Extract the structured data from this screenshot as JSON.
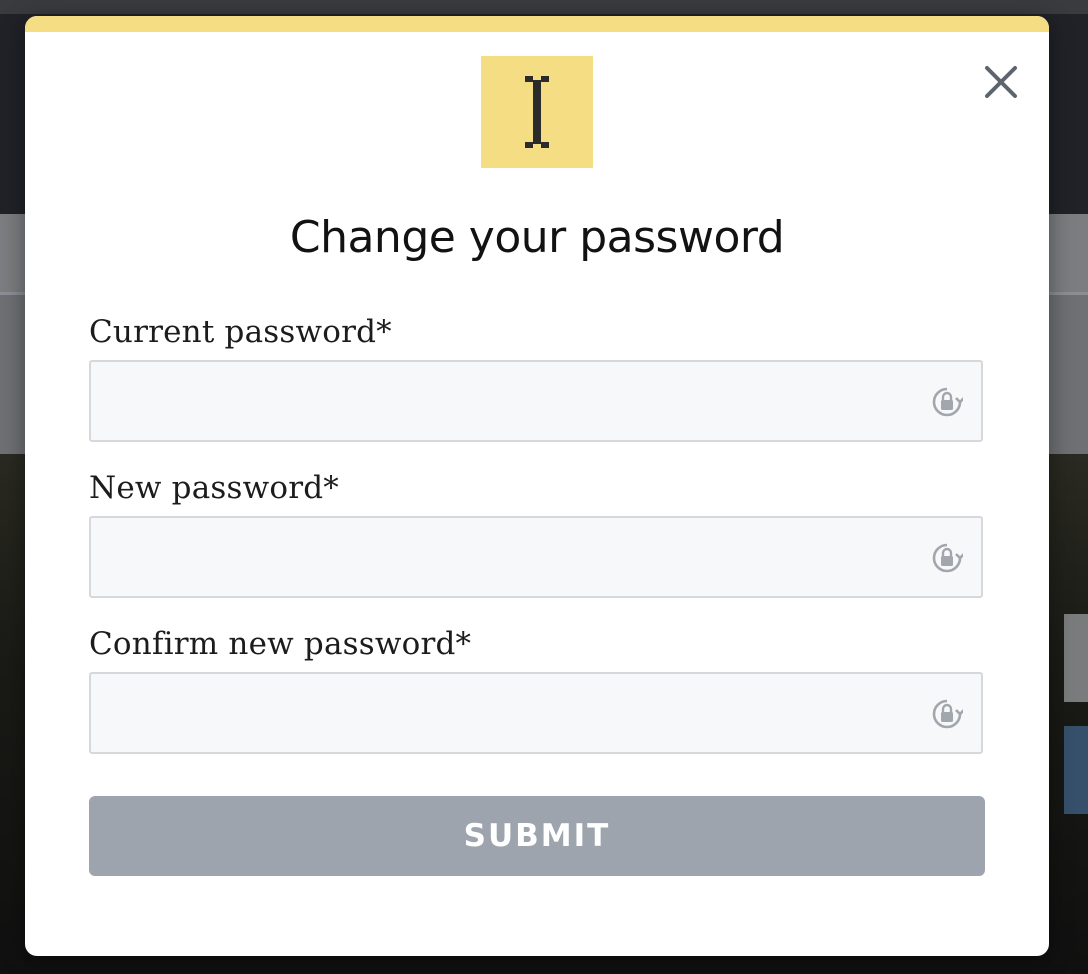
{
  "modal": {
    "title": "Change your password",
    "accent_color": "#f4dd83",
    "logo_icon": "text-cursor-icon",
    "close_icon": "close-icon"
  },
  "form": {
    "fields": [
      {
        "label": "Current password*",
        "value": "",
        "placeholder": "",
        "icon": "password-manager-lock-icon"
      },
      {
        "label": "New password*",
        "value": "",
        "placeholder": "",
        "icon": "password-manager-lock-icon"
      },
      {
        "label": "Confirm new password*",
        "value": "",
        "placeholder": "",
        "icon": "password-manager-lock-icon"
      }
    ],
    "submit_label": "SUBMIT",
    "submit_color": "#9ea4ae"
  }
}
